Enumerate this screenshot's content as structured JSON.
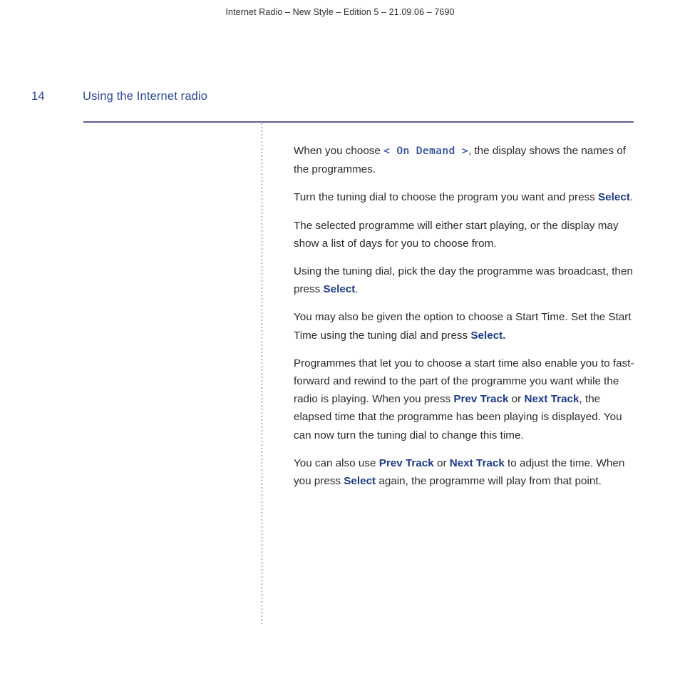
{
  "document": {
    "running_header": "Internet Radio – New Style – Edition 5 – 21.09.06 – 7690",
    "folio": "14",
    "chapter_title": "Using the Internet radio"
  },
  "colors": {
    "rule": "#5d5d96",
    "heading": "#2c4a9a",
    "button_reference": "#1b3a86",
    "body_text": "#2a2a2a",
    "lcd_text": "#2c4a9a",
    "page_background": "#ffffff"
  },
  "body": {
    "paragraphs": [
      {
        "id": "p1",
        "runs": [
          {
            "text": "When you choose ",
            "style": "normal"
          },
          {
            "text": "< On Demand >",
            "style": "lcd"
          },
          {
            "text": ", the display shows the names of the programmes.",
            "style": "normal"
          }
        ]
      },
      {
        "id": "p2",
        "runs": [
          {
            "text": "Turn the tuning dial to choose the program you want and press ",
            "style": "normal"
          },
          {
            "text": "Select",
            "style": "button"
          },
          {
            "text": ".",
            "style": "normal"
          }
        ]
      },
      {
        "id": "p3",
        "runs": [
          {
            "text": "The selected programme will either start playing, or the display may show a list of days for you to choose from.",
            "style": "normal"
          }
        ]
      },
      {
        "id": "p4",
        "runs": [
          {
            "text": "Using the tuning dial, pick the day the programme was broadcast, then press ",
            "style": "normal"
          },
          {
            "text": "Select",
            "style": "button"
          },
          {
            "text": ".",
            "style": "normal"
          }
        ]
      },
      {
        "id": "p5",
        "runs": [
          {
            "text": "You may also be given the option to choose a Start Time. Set the Start Time using the tuning dial and press ",
            "style": "normal"
          },
          {
            "text": "Select.",
            "style": "button"
          }
        ]
      },
      {
        "id": "p6",
        "runs": [
          {
            "text": "Programmes that let you to choose a start time also enable you to fast-forward and rewind to the part of the programme you want while the radio is playing. When you press ",
            "style": "normal"
          },
          {
            "text": "Prev Track",
            "style": "button"
          },
          {
            "text": " or ",
            "style": "normal"
          },
          {
            "text": "Next Track",
            "style": "button"
          },
          {
            "text": ", the elapsed time that the programme has been playing is displayed. You can now turn the tuning dial to change this time.",
            "style": "normal"
          }
        ]
      },
      {
        "id": "p7",
        "runs": [
          {
            "text": "You can also use ",
            "style": "normal"
          },
          {
            "text": "Prev Track",
            "style": "button"
          },
          {
            "text": " or ",
            "style": "normal"
          },
          {
            "text": "Next Track",
            "style": "button"
          },
          {
            "text": " to adjust the time. When you press ",
            "style": "normal"
          },
          {
            "text": "Select",
            "style": "button"
          },
          {
            "text": " again, the programme will play from that point.",
            "style": "normal"
          }
        ]
      }
    ]
  }
}
